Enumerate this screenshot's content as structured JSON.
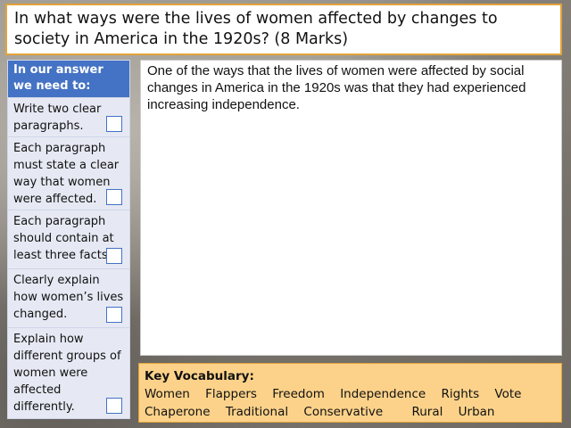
{
  "title": "In what ways were the lives of women affected by changes to society in America in the 1920s? (8 Marks)",
  "checklist": {
    "header": "In our answer we need to:",
    "items": [
      {
        "text": "Write two clear paragraphs."
      },
      {
        "text": "Each paragraph must state a clear way that women were affected."
      },
      {
        "text": "Each paragraph should contain at least three facts."
      },
      {
        "text": "Clearly explain how women’s lives changed."
      },
      {
        "text": "Explain how different groups of women were affected differently."
      }
    ]
  },
  "answer": {
    "text": "One of the ways that the lives of women were affected by social changes in America in the 1920s was that they had experienced increasing independence."
  },
  "vocabulary": {
    "title": "Key Vocabulary:",
    "row1": [
      "Women",
      "Flappers",
      "Freedom",
      "Independence",
      "Rights",
      "Vote"
    ],
    "row2": [
      "Chaperone",
      "Traditional",
      "Conservative",
      "Rural",
      "Urban"
    ]
  },
  "colors": {
    "accent_orange": "#e2a33a",
    "header_blue": "#4472c4",
    "checklist_bg": "#e6e9f3",
    "vocab_bg": "#fcd28a"
  }
}
